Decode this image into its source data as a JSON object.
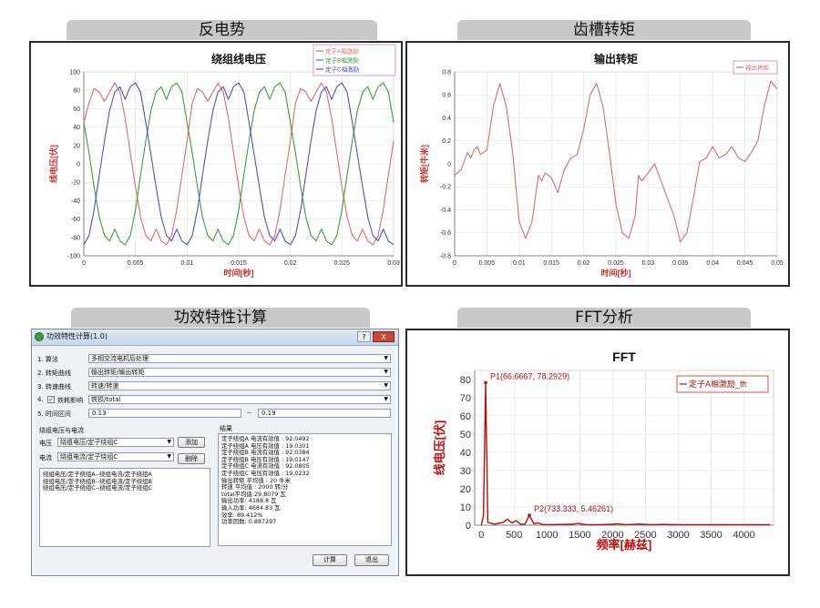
{
  "panels": {
    "back_emf": "反电势",
    "cogging": "齿槽转矩",
    "efficiency": "功效特性计算",
    "fft": "FFT分析"
  },
  "chart_data": [
    {
      "type": "line",
      "title": "绕组线电压",
      "xlabel": "时间[秒]",
      "ylabel": "线电压[伏]",
      "xlim": [
        0,
        0.03
      ],
      "ylim": [
        -100,
        100
      ],
      "x_ticks": [
        "0",
        "0.005",
        "0.01",
        "0.015",
        "0.02",
        "0.025",
        "0.03"
      ],
      "y_ticks": [
        "100",
        "80",
        "60",
        "40",
        "20",
        "0",
        "-20",
        "-40",
        "-60",
        "-80",
        "-100"
      ],
      "legend": "top-right",
      "grid": true,
      "series": [
        {
          "name": "定子A相激励",
          "color": "#e06a6a",
          "x": [
            0,
            0.0005,
            0.001,
            0.0015,
            0.002,
            0.0025,
            0.003,
            0.0035,
            0.004,
            0.0045,
            0.005,
            0.0055,
            0.006,
            0.0065,
            0.007,
            0.0075,
            0.008,
            0.0085,
            0.009,
            0.0095,
            0.01
          ],
          "y": [
            45,
            66,
            82,
            78,
            68,
            78,
            88,
            78,
            50,
            12,
            -25,
            -58,
            -78,
            -84,
            -71,
            -84,
            -88,
            -78,
            -50,
            -12,
            25
          ]
        },
        {
          "name": "定子B相激励",
          "color": "#3f9a3f",
          "x": [
            0,
            0.0005,
            0.001,
            0.0015,
            0.002,
            0.0025,
            0.003,
            0.0035,
            0.004,
            0.0045,
            0.005,
            0.0055,
            0.006,
            0.0065,
            0.007,
            0.0075,
            0.008,
            0.0085,
            0.009,
            0.0095,
            0.01
          ],
          "y": [
            45,
            12,
            -25,
            -58,
            -78,
            -84,
            -71,
            -84,
            -88,
            -78,
            -50,
            -12,
            25,
            58,
            78,
            84,
            70,
            84,
            88,
            78,
            45
          ]
        },
        {
          "name": "定子C相激励",
          "color": "#4f4fc8",
          "x": [
            0,
            0.0005,
            0.001,
            0.0015,
            0.002,
            0.0025,
            0.003,
            0.0035,
            0.004,
            0.0045,
            0.005,
            0.0055,
            0.006,
            0.0065,
            0.007,
            0.0075,
            0.008,
            0.0085,
            0.009,
            0.0095,
            0.01
          ],
          "y": [
            -88,
            -78,
            -50,
            -12,
            25,
            58,
            78,
            84,
            70,
            84,
            88,
            78,
            45,
            10,
            -25,
            -58,
            -78,
            -84,
            -71,
            -84,
            -88
          ]
        }
      ]
    },
    {
      "type": "line",
      "title": "输出转矩",
      "xlabel": "时间[秒]",
      "ylabel": "转矩[牛米]",
      "xlim": [
        0,
        0.05
      ],
      "ylim": [
        -0.8,
        0.8
      ],
      "x_ticks": [
        "0",
        "0.005",
        "0.01",
        "0.015",
        "0.02",
        "0.025",
        "0.03",
        "0.035",
        "0.04",
        "0.045",
        "0.05"
      ],
      "y_ticks": [
        "0.8",
        "0.6",
        "0.4",
        "0.2",
        "0",
        "-0.2",
        "-0.4",
        "-0.6",
        "-0.8"
      ],
      "legend": "top-right",
      "grid": true,
      "series": [
        {
          "name": "输出转矩",
          "color": "#e06a6a",
          "x": [
            0,
            0.001,
            0.002,
            0.0025,
            0.003,
            0.0035,
            0.004,
            0.005,
            0.006,
            0.007,
            0.008,
            0.009,
            0.01,
            0.011,
            0.012,
            0.013,
            0.0135,
            0.014,
            0.015,
            0.016,
            0.017,
            0.018,
            0.019,
            0.02,
            0.021,
            0.022,
            0.023,
            0.024,
            0.025,
            0.026,
            0.027,
            0.028,
            0.0285,
            0.029,
            0.03,
            0.031,
            0.032,
            0.033,
            0.034,
            0.035,
            0.036,
            0.037,
            0.038,
            0.039,
            0.04,
            0.041,
            0.042,
            0.043,
            0.044,
            0.045,
            0.046,
            0.047,
            0.048,
            0.049,
            0.05
          ],
          "y": [
            -0.1,
            -0.05,
            0.1,
            0.05,
            0.12,
            0.15,
            0.08,
            0.12,
            0.5,
            0.7,
            0.5,
            0.1,
            -0.5,
            -0.65,
            -0.5,
            -0.1,
            -0.15,
            -0.08,
            -0.12,
            -0.25,
            -0.05,
            0.05,
            0.08,
            0.3,
            0.6,
            0.7,
            0.5,
            0.1,
            -0.35,
            -0.6,
            -0.65,
            -0.45,
            -0.1,
            -0.15,
            -0.08,
            0.0,
            -0.15,
            -0.3,
            -0.45,
            -0.68,
            -0.6,
            -0.3,
            0.02,
            0.05,
            0.15,
            0.05,
            0.08,
            0.15,
            0.05,
            0.02,
            0.1,
            0.2,
            0.5,
            0.72,
            0.65
          ]
        }
      ]
    },
    {
      "type": "line",
      "title": "FFT",
      "xlabel": "频率[赫兹]",
      "ylabel": "线电压[伏]",
      "xlim": [
        -100,
        4450
      ],
      "ylim": [
        0,
        85
      ],
      "x_ticks": [
        "0",
        "500",
        "1000",
        "1500",
        "2000",
        "2500",
        "3000",
        "3500",
        "4000"
      ],
      "y_ticks": [
        "0",
        "10",
        "20",
        "30",
        "40",
        "50",
        "60",
        "70",
        "80"
      ],
      "legend": "top-right",
      "grid": true,
      "annotations": [
        "P1(66.6667, 78.2929)",
        "P2(733.333, 5.46261)"
      ],
      "series": [
        {
          "name": "定子A相激励_fft",
          "color": "#b01010",
          "x": [
            0,
            33,
            50,
            66.7,
            83,
            100,
            200,
            333,
            400,
            466,
            533,
            600,
            666,
            733,
            800,
            866,
            933,
            1000,
            1200,
            1400,
            1466,
            1600,
            1800,
            2000,
            2066,
            2200,
            2400,
            2600,
            2800,
            3000,
            3500,
            4000,
            4400
          ],
          "y": [
            0,
            5,
            40,
            78.29,
            40,
            1.5,
            0.6,
            1.5,
            3.2,
            1.2,
            2.5,
            0.5,
            0.6,
            5.46,
            0.8,
            1.2,
            0.4,
            0.3,
            0.4,
            0.5,
            1.0,
            0.3,
            0.3,
            0.5,
            0.8,
            0.3,
            0.6,
            0.3,
            0.4,
            0.3,
            0.3,
            0.3,
            0.3
          ]
        }
      ]
    }
  ],
  "dialog": {
    "title": "功效特性计算(1.0)",
    "help_label": "?",
    "close_label": "X",
    "rows": [
      {
        "label": "1. 算法",
        "value": "多相交流电机后处理"
      },
      {
        "label": "2. 转矩曲线",
        "value": "输出转矩/输出转矩"
      },
      {
        "label": "3. 转速曲线",
        "value": "转速/转速"
      },
      {
        "label": "4.",
        "check": "✓",
        "check_label": "铁耗影响",
        "value": "铁损/total"
      }
    ],
    "time_label": "5. 时间区间",
    "time_from": "0.13",
    "time_sep": "--",
    "time_to": "0.19",
    "group_title": "绕组电压与电流",
    "voltage_label": "电压",
    "voltage_value": "绕组电压/定子绕组C",
    "current_label": "电流",
    "current_value": "绕组电流/定子绕组C",
    "add_button": "添加",
    "delete_button": "删除",
    "pairs": [
      "绕组电压/定子绕组A--绕组电流/定子绕组A",
      "绕组电压/定子绕组B--绕组电流/定子绕组B",
      "绕组电压/定子绕组C--绕组电流/定子绕组C"
    ],
    "result_title": "结果",
    "results": [
      "定子绕组A 电流有效值 : 92.0492",
      "定子绕组A 电压有效值 : 19.0301",
      "定子绕组B 电流有效值 : 92.0384",
      "定子绕组B 电压有效值 : 19.0147",
      "定子绕组C 电流有效值 : 92.0805",
      "定子绕组C 电压有效值 : 19.0232",
      "输出转矩 平均值 : 20 牛米",
      "转速 平均值 : 2000 转/分",
      "total平均值:29.8079 瓦",
      "输出功率: 4188.8 瓦",
      "输入功率: 4684.83 瓦",
      "效率: 89.412%",
      "功率因数: 0.887297"
    ],
    "calc_button": "计算",
    "exit_button": "退出"
  }
}
